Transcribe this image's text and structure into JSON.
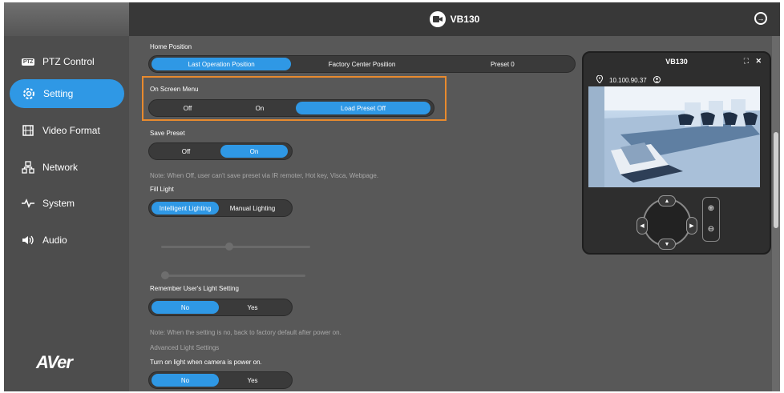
{
  "header": {
    "camera_name": "VB130"
  },
  "sidebar": {
    "items": [
      {
        "label": "PTZ Control",
        "icon": "ptz-icon",
        "badge": "PTZ"
      },
      {
        "label": "Setting",
        "icon": "gear-icon"
      },
      {
        "label": "Video Format",
        "icon": "film-icon"
      },
      {
        "label": "Network",
        "icon": "network-icon"
      },
      {
        "label": "System",
        "icon": "pulse-icon"
      },
      {
        "label": "Audio",
        "icon": "speaker-icon"
      }
    ],
    "active": "Setting",
    "logo": "AVer"
  },
  "settings": {
    "home_position": {
      "label": "Home Position",
      "options": [
        "Last Operation Position",
        "Factory Center Position",
        "Preset 0"
      ],
      "selected": "Last Operation Position"
    },
    "on_screen_menu": {
      "label": "On Screen Menu",
      "options": [
        "Off",
        "On",
        "Load Preset Off"
      ],
      "selected": "Load Preset Off"
    },
    "save_preset": {
      "label": "Save Preset",
      "options": [
        "Off",
        "On"
      ],
      "selected": "On",
      "note": "Note: When Off, user can't save preset via IR remoter, Hot key, Visca, Webpage."
    },
    "fill_light": {
      "label": "Fill Light",
      "options": [
        "Intelligent Lighting",
        "Manual Lighting"
      ],
      "selected": "Intelligent Lighting"
    },
    "remember_light": {
      "label": "Remember User's Light Setting",
      "options": [
        "No",
        "Yes"
      ],
      "selected": "No",
      "note": "Note: When the setting is no, back to factory default after power on."
    },
    "advanced_light": {
      "label": "Advanced Light Settings"
    },
    "turn_on_light": {
      "label": "Turn on light when camera is power on.",
      "options": [
        "No",
        "Yes"
      ],
      "selected": "No"
    }
  },
  "preview": {
    "title": "VB130",
    "ip": "10.100.90.37",
    "icons": [
      "location-icon",
      "user-icon",
      "fullscreen-icon",
      "close-icon",
      "zoom-in-icon",
      "zoom-out-icon"
    ]
  },
  "colors": {
    "accent": "#2f98e5",
    "highlight": "#e88a2e",
    "sidebar_bg": "#4d4d4d",
    "content_bg": "#585858"
  }
}
